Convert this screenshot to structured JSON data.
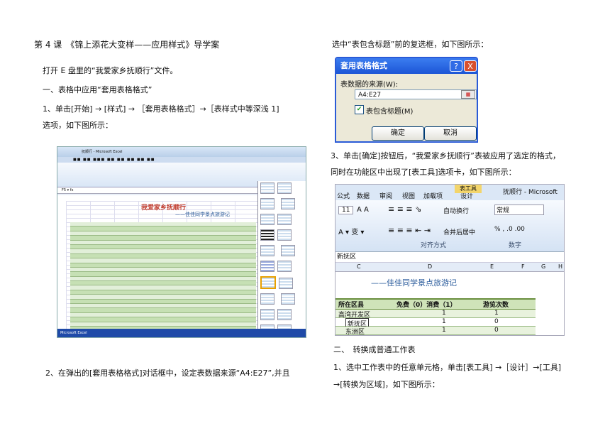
{
  "left": {
    "heading": "第 4 课　《锦上添花大变样——应用样式》导学案",
    "intro": "打开 E 盘里的“我爱家乡抚顺行”文件。",
    "section1": "一、表格中应用“套用表格格式”",
    "step1_line1": "1、单击[开始] → [样式] → ［套用表格格式］→［表样式中等深浅 1]",
    "step1_line2": "选项，如下图所示：",
    "step2": "2、在弹出的[套用表格格式]对话框中，设定表数据来源“A4:E27”,并且"
  },
  "right": {
    "step2_cont": "选中“表包含标题”前的复选框，如下图所示：",
    "step3_line1": "3、单击[确定]按钮后，“我爱家乡抚顺行”表被应用了选定的格式，",
    "step3_line2": "同时在功能区中出现了[表工具]选项卡，如下图所示：",
    "section2": "二、　转换成普通工作表",
    "s2_step1_line1": "1、选中工作表中的任意单元格，单击[表工具] →［设计］→[工具]",
    "s2_step1_line2": "→[转换为区域]，如下图所示："
  },
  "excel": {
    "window_title": "抚顺行 - Microsoft Excel",
    "sheet_title": "我爱家乡抚顺行",
    "sheet_subtitle": "——佳佳同学景点旅游记",
    "taskbar": "Microsoft Excel"
  },
  "dialog": {
    "title": "套用表格格式",
    "help": "?",
    "close": "X",
    "source_label": "表数据的来源(W):",
    "source_value": "A4:E27",
    "checkbox_label": "表包含标题(M)",
    "checked": true,
    "ok": "确定",
    "cancel": "取消"
  },
  "ribbon": {
    "tabs": [
      "公式",
      "数据",
      "审阅",
      "视图",
      "加载项",
      "设计"
    ],
    "context_tab": "表工具",
    "window_title": "抚顺行 - Microsoft Exc",
    "font_size": "11",
    "wrap_text": "自动换行",
    "merge": "合并后居中",
    "number_format": "常规",
    "group_align": "对齐方式",
    "group_number": "数字",
    "name_box": "新抚区",
    "columns": [
      "C",
      "D",
      "E",
      "F",
      "G",
      "H"
    ],
    "subtitle": "——佳佳同学景点旅游记",
    "headers": [
      "所在区县",
      "免费（0）消费（1）",
      "游览次数"
    ],
    "rows": [
      [
        "高湾开发区",
        "1",
        "1"
      ],
      [
        "新抚区",
        "1",
        "0"
      ],
      [
        "东洲区",
        "1",
        "0"
      ]
    ]
  }
}
